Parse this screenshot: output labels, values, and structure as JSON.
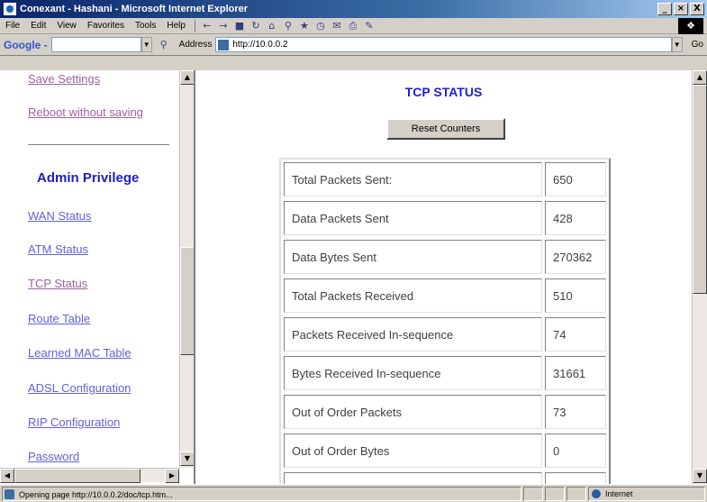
{
  "window": {
    "title": "Conexant - Hashani - Microsoft Internet Explorer",
    "controls": {
      "minimize": "_",
      "maximize": "×",
      "close": "X"
    }
  },
  "menu": [
    "File",
    "Edit",
    "View",
    "Favorites",
    "Tools",
    "Help"
  ],
  "google_bar": {
    "logo": "Google -"
  },
  "address_bar": {
    "label": "Address",
    "url": "http://10.0.0.2",
    "go": "Go"
  },
  "left_nav": {
    "top_links": [
      "Save Settings",
      "Reboot without saving"
    ],
    "heading": "Admin Privilege",
    "links": [
      "WAN Status",
      "ATM Status",
      "TCP Status",
      "Route Table",
      "Learned MAC Table",
      "ADSL Configuration",
      "RIP Configuration",
      "Password"
    ]
  },
  "main": {
    "title": "TCP STATUS",
    "reset_button": "Reset Counters",
    "rows": [
      {
        "label": "Total Packets Sent:",
        "value": "650"
      },
      {
        "label": "Data Packets Sent",
        "value": "428"
      },
      {
        "label": "Data Bytes Sent",
        "value": "270362"
      },
      {
        "label": "Total Packets Received",
        "value": "510"
      },
      {
        "label": "Packets Received In-sequence",
        "value": "74"
      },
      {
        "label": "Bytes Received In-sequence",
        "value": "31661"
      },
      {
        "label": "Out of Order Packets",
        "value": "73"
      },
      {
        "label": "Out of Order Bytes",
        "value": "0"
      }
    ]
  },
  "status_bar": {
    "text": "Opening page http://10.0.0.2/doc/tcp.htm...",
    "zone": "Internet"
  }
}
